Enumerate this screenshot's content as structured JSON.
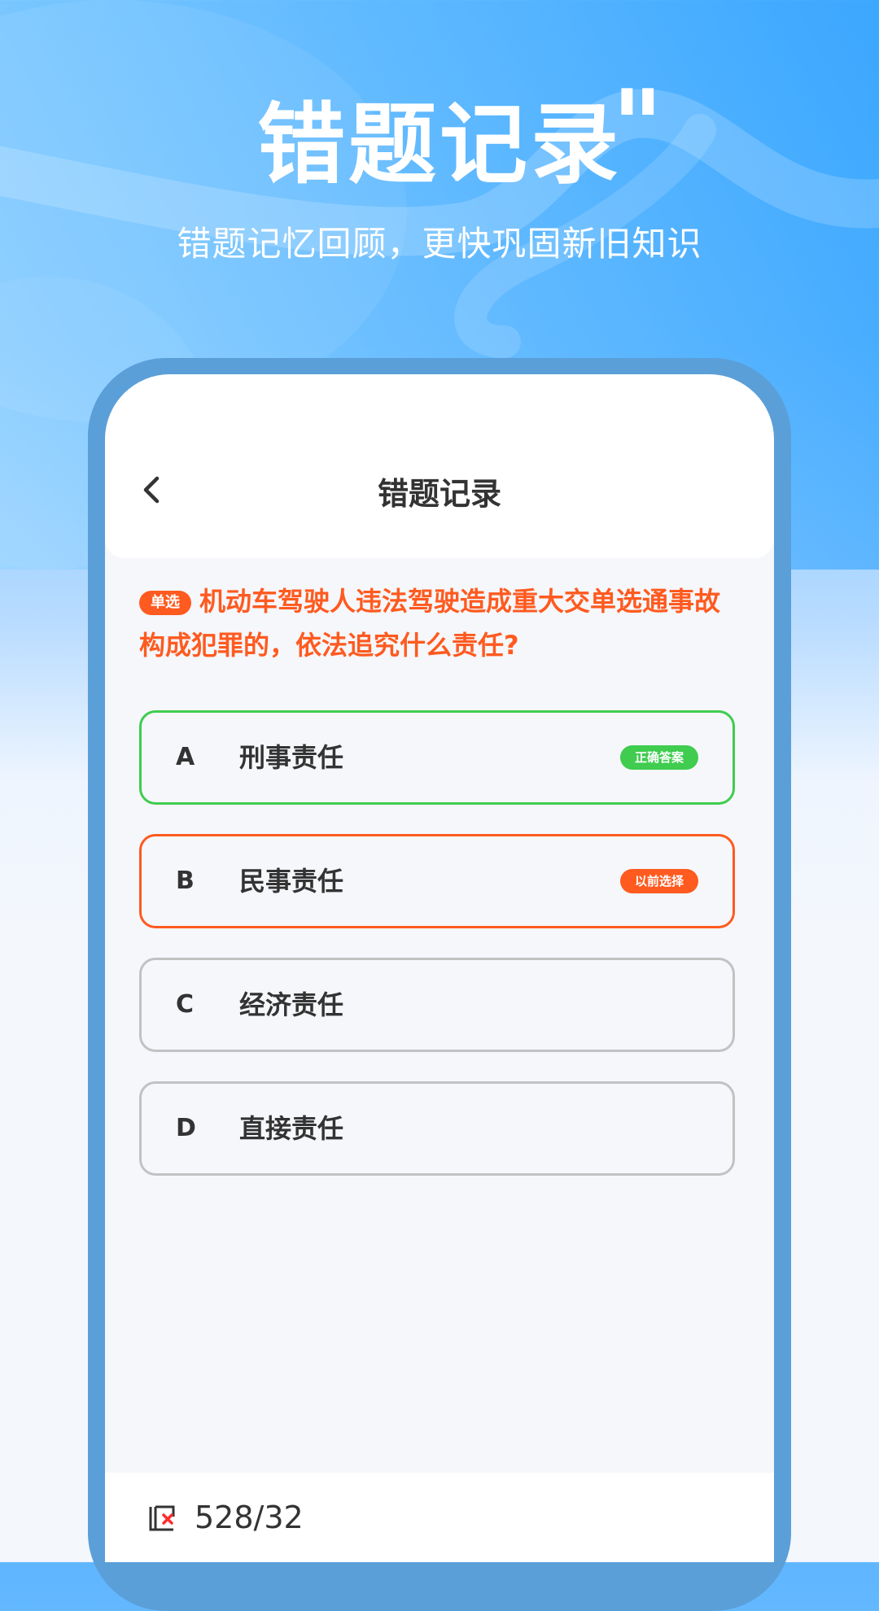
{
  "hero": {
    "title": "错题记录",
    "quote_mark": "\"",
    "subtitle": "错题记忆回顾，更快巩固新旧知识"
  },
  "nav": {
    "back_icon": "chevron-left-icon",
    "title": "错题记录"
  },
  "question": {
    "tag": "单选",
    "text": "机动车驾驶人违法驾驶造成重大交单选通事故构成犯罪的，依法追究什么责任?"
  },
  "options": [
    {
      "letter": "A",
      "text": "刑事责任",
      "badge": "正确答案",
      "state": "correct"
    },
    {
      "letter": "B",
      "text": "民事责任",
      "badge": "以前选择",
      "state": "selected"
    },
    {
      "letter": "C",
      "text": "经济责任",
      "badge": "",
      "state": "normal"
    },
    {
      "letter": "D",
      "text": "直接责任",
      "badge": "",
      "state": "normal"
    }
  ],
  "footer": {
    "icon": "wrong-book-icon",
    "counter": "528/32"
  },
  "colors": {
    "accent_blue": "#5b9fd9",
    "correct_green": "#3fcc4f",
    "wrong_orange": "#ff5a1f",
    "text_dark": "#333333"
  }
}
